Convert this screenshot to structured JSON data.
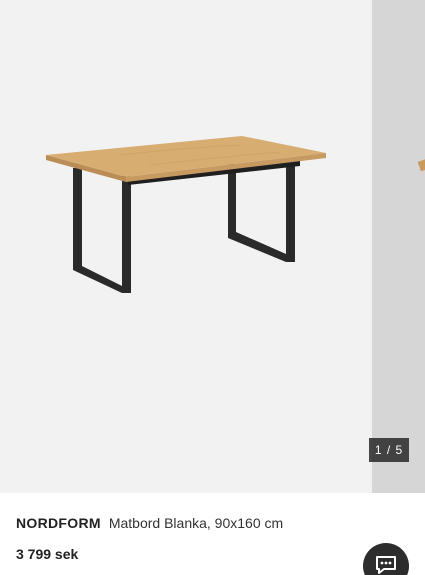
{
  "gallery": {
    "counter": "1 / 5",
    "current_index": 1,
    "total": 5
  },
  "product": {
    "brand": "NORDFORM",
    "name": "Matbord Blanka, 90x160 cm",
    "price": "3 799 sek"
  },
  "icons": {
    "chat": "chat-icon"
  },
  "colors": {
    "tabletop": "#d8ad72",
    "legs": "#2a2a2a",
    "counter_bg": "#2d2d2d",
    "chat_button_bg": "#2d2d2d"
  }
}
